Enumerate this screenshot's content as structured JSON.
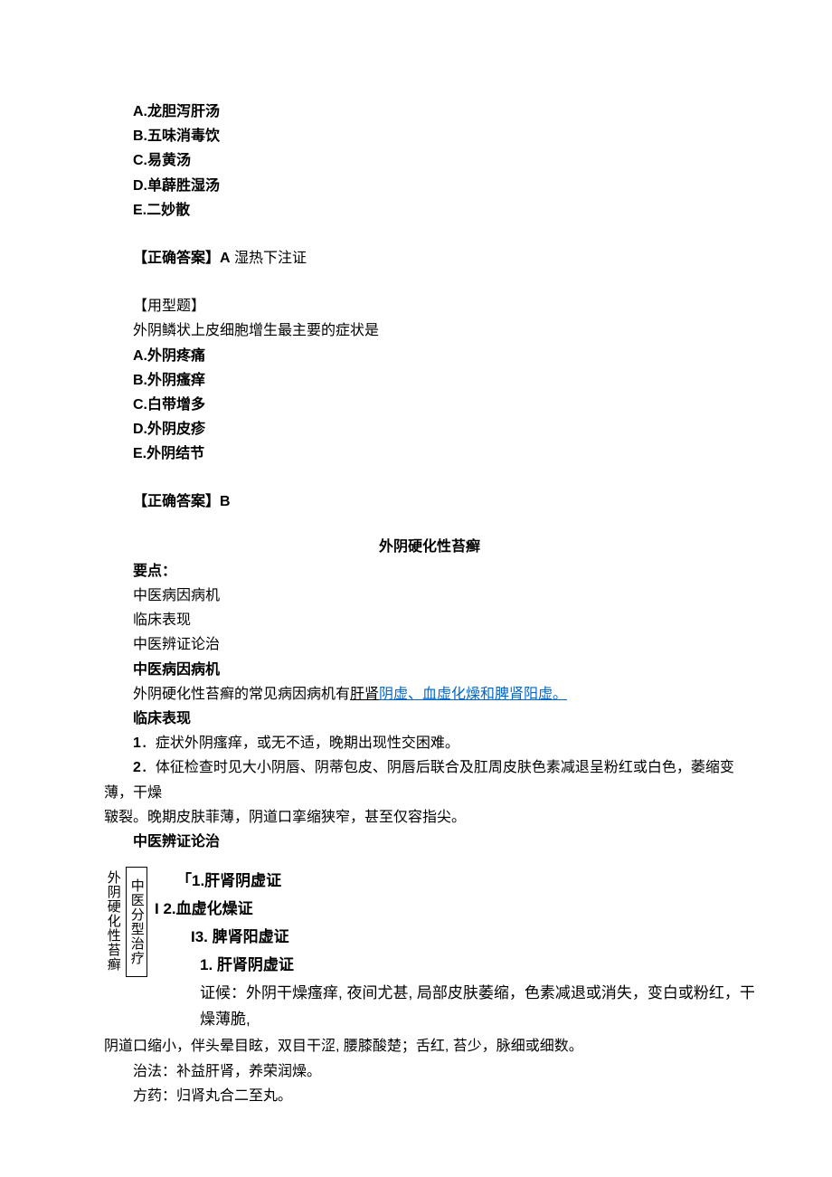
{
  "q1": {
    "A": "A.龙胆泻肝汤",
    "B": "B.五味消毒饮",
    "C": "C.易黄汤",
    "D": "D.单薜胜湿汤",
    "E": "E.二妙散",
    "ans_label": "【正确答案】A",
    "ans_note": " 湿热下注证"
  },
  "q2": {
    "type": "【用型题】",
    "stem": "外阴鳞状上皮细胞增生最主要的症状是",
    "A": "A.外阴疼痛",
    "B": "B.外阴瘙痒",
    "C": "C.白带增多",
    "D": "D.外阴皮疹",
    "E": "E.外阴结节",
    "ans": "【正确答案】B"
  },
  "sec_title": "外阴硬化性苔癣",
  "pts_label": "要点：",
  "pts": {
    "a": "中医病因病机",
    "b": "临床表现",
    "c": "中医辨证论治"
  },
  "etio": {
    "hd": "中医病因病机",
    "t1": "外阴硬化性苔癣的常见病因病机有",
    "u1": "肝肾",
    "l1": "阴虚、血虚化燥和脾肾阳虚。"
  },
  "clin": {
    "hd": "临床表现",
    "i1_n": "1",
    "i1": "．症状外阴瘙痒，或无不适，晚期出现性交困难。",
    "i2_n": "2",
    "i2a": "．体征检查时见大小阴唇、阴蒂包皮、阴唇后联合及肛周皮肤色素减退呈粉红或白色，萎缩变薄，干燥",
    "i2b": "皲裂。晚期皮肤菲薄，阴道口挛缩狭窄，甚至仅容指尖。"
  },
  "tcm": {
    "hd": "中医辨证论治",
    "vt1": "外阴硬化性苔癣",
    "vt2": "中医分型治疗",
    "r1": "「1.肝肾阴虚证",
    "r2": "I 2.血虚化燥证",
    "r3": "I3. 脾肾阳虚证",
    "s1_hd": "1. 肝肾阴虚证",
    "s1a": "证候：外阴干燥瘙痒, 夜间尤甚, 局部皮肤萎缩，色素减退或消失，变白或粉红，干燥薄脆,",
    "s1b": "阴道口缩小，伴头晕目眩，双目干涩, 腰膝酸楚；舌红, 苔少，脉细或细数。",
    "s1c": "治法：补益肝肾，养荣润燥。",
    "s1d": "方药：归肾丸合二至丸。"
  }
}
